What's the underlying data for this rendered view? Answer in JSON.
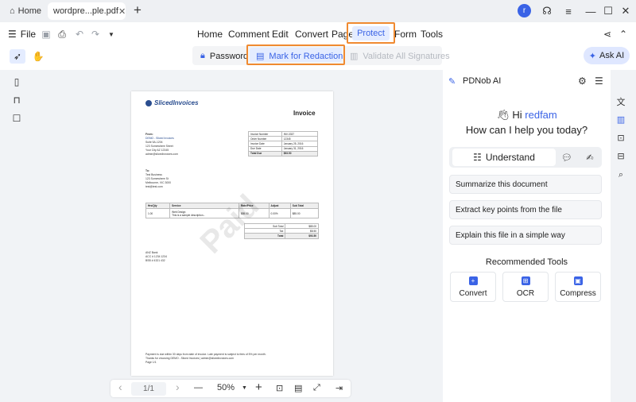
{
  "tabs": {
    "home_label": "Home",
    "file_label": "wordpre...ple.pdf",
    "close_glyph": "✕",
    "new_tab_glyph": "+"
  },
  "window": {
    "avatar_letter": "r",
    "support_glyph": "☊",
    "menu_glyph": "≡",
    "minimize_glyph": "—",
    "maximize_glyph": "☐",
    "close_glyph": "✕"
  },
  "toolbar": {
    "file_label": "File",
    "menus": [
      "Home",
      "Comment",
      "Edit",
      "Convert",
      "Page",
      "Protect",
      "Form",
      "Tools"
    ],
    "active_menu": "Protect",
    "share_glyph": "⋖",
    "collapse_glyph": "⌃"
  },
  "protect_tools": {
    "password_label": "Password",
    "redaction_label": "Mark for Redaction",
    "signatures_label": "Validate All Signatures",
    "ask_ai_label": "Ask AI"
  },
  "document": {
    "logo_text": "SlicedInvoices",
    "invoice_title": "Invoice",
    "from_label": "From:",
    "from_lines": [
      "DEMO - Sliced Invoices",
      "Suite 5A-1204",
      "123 Somewhere Street",
      "Your City AZ 12345",
      "admin@slicedinvoices.com"
    ],
    "to_label": "To:",
    "to_lines": [
      "Test Business",
      "123 Somewhere St",
      "Melbourne, VIC 3000",
      "test@test.com"
    ],
    "meta": [
      [
        "Invoice Number",
        "INV-3337"
      ],
      [
        "Order Number",
        "12345"
      ],
      [
        "Invoice Date",
        "January 25, 2016"
      ],
      [
        "Due Date",
        "January 31, 2016"
      ],
      [
        "Total Due",
        "$93.50"
      ]
    ],
    "item_headers": [
      "Hrs/Qty",
      "Service",
      "Rate/Price",
      "Adjust",
      "Sub Total"
    ],
    "items": [
      [
        "1.00",
        "Web Design\nThis is a sample description...",
        "$85.00",
        "0.00%",
        "$85.00"
      ]
    ],
    "totals": [
      [
        "Sub Total",
        "$85.00"
      ],
      [
        "Tax",
        "$8.50"
      ],
      [
        "Total",
        "$93.50"
      ]
    ],
    "bank_lines": [
      "ANZ Bank",
      "ACC # 1234 1234",
      "BSB # 4321 432"
    ],
    "footer_lines": [
      "Payment is due within 30 days from date of invoice. Late payment is subject to fees of 5% per month.",
      "Thanks for choosing DEMO - Sliced Invoices | admin@slicedinvoices.com",
      "Page 1/1"
    ],
    "watermark": "Paid"
  },
  "pagination": {
    "page_display": "1/1",
    "zoom": "50%",
    "prev_glyph": "‹",
    "next_glyph": "›",
    "zoom_out_glyph": "—",
    "zoom_in_glyph": "+"
  },
  "ai_panel": {
    "title": "PDNob AI",
    "greeting_prefix": "Hi",
    "user_name": "redfam",
    "question": "How can I help you today?",
    "mode_label": "Understand",
    "prompts": [
      "Summarize this document",
      "Extract key points from the file",
      "Explain this file in a simple way"
    ],
    "recommended_title": "Recommended Tools",
    "tools": [
      "Convert",
      "OCR",
      "Compress"
    ]
  },
  "colors": {
    "accent": "#3a63e6",
    "highlight_border": "#f08a30",
    "active_bg": "#e4ecff"
  }
}
